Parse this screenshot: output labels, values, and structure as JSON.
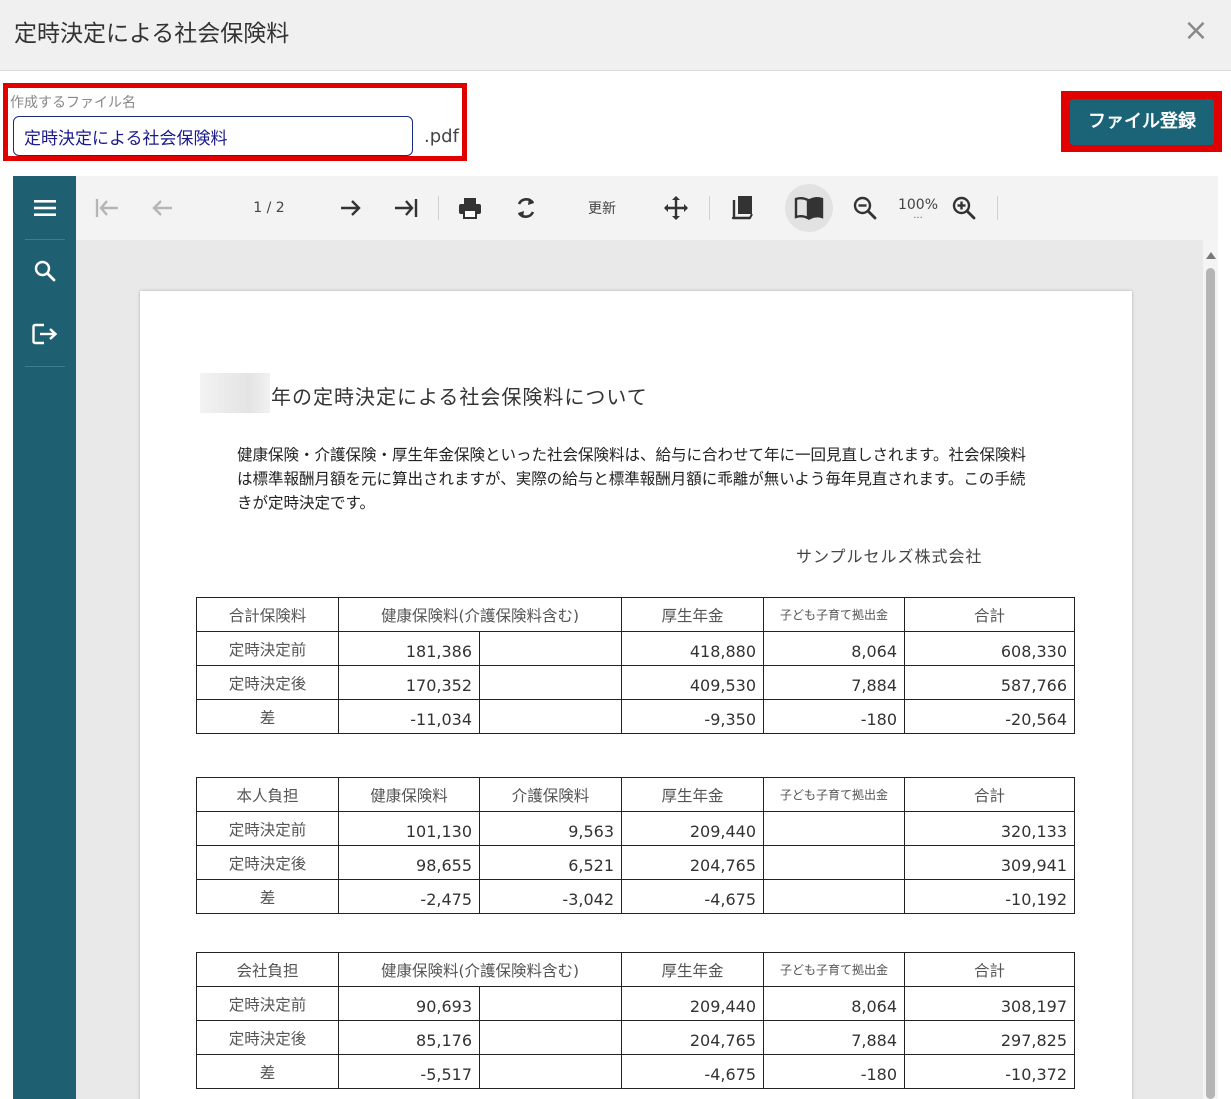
{
  "dialog": {
    "title": "定時決定による社会保険料",
    "close_symbol": "×"
  },
  "filename": {
    "label": "作成するファイル名",
    "value": "定時決定による社会保険料",
    "extension": ".pdf"
  },
  "register_button": "ファイル登録",
  "toolbar": {
    "page_indicator": "1 / 2",
    "refresh_label": "更新",
    "zoom": "100%",
    "zoom_more": "..."
  },
  "document": {
    "title": "年の定時決定による社会保険料について",
    "intro": "健康保険・介護保険・厚生年金保険といった社会保険料は、給与に合わせて年に一回見直しされます。社会保険料は標準報酬月額を元に算出されますが、実際の給与と標準報酬月額に乖離が無いよう毎年見直されます。この手続きが定時決定です。",
    "company": "サンプルセルズ株式会社",
    "tables": [
      {
        "headers": [
          "合計保険料",
          "健康保険料(介護保険料含む)",
          "厚生年金",
          "子ども子育て拠出金",
          "合計"
        ],
        "rows": [
          {
            "label": "定時決定前",
            "health": "181,386",
            "care": "",
            "pension": "418,880",
            "child": "8,064",
            "total": "608,330"
          },
          {
            "label": "定時決定後",
            "health": "170,352",
            "care": "",
            "pension": "409,530",
            "child": "7,884",
            "total": "587,766"
          },
          {
            "label": "差",
            "health": "-11,034",
            "care": "",
            "pension": "-9,350",
            "child": "-180",
            "total": "-20,564"
          }
        ]
      },
      {
        "headers": [
          "本人負担",
          "健康保険料",
          "介護保険料",
          "厚生年金",
          "子ども子育て拠出金",
          "合計"
        ],
        "rows": [
          {
            "label": "定時決定前",
            "health": "101,130",
            "care": "9,563",
            "pension": "209,440",
            "child": "",
            "total": "320,133"
          },
          {
            "label": "定時決定後",
            "health": "98,655",
            "care": "6,521",
            "pension": "204,765",
            "child": "",
            "total": "309,941"
          },
          {
            "label": "差",
            "health": "-2,475",
            "care": "-3,042",
            "pension": "-4,675",
            "child": "",
            "total": "-10,192"
          }
        ]
      },
      {
        "headers": [
          "会社負担",
          "健康保険料(介護保険料含む)",
          "厚生年金",
          "子ども子育て拠出金",
          "合計"
        ],
        "rows": [
          {
            "label": "定時決定前",
            "health": "90,693",
            "care": "",
            "pension": "209,440",
            "child": "8,064",
            "total": "308,197"
          },
          {
            "label": "定時決定後",
            "health": "85,176",
            "care": "",
            "pension": "204,765",
            "child": "7,884",
            "total": "297,825"
          },
          {
            "label": "差",
            "health": "-5,517",
            "care": "",
            "pension": "-4,675",
            "child": "-180",
            "total": "-10,372"
          }
        ]
      }
    ]
  },
  "colors": {
    "rail": "#1f5f72",
    "register_button": "#1b6477",
    "highlight_border": "#e00000"
  }
}
